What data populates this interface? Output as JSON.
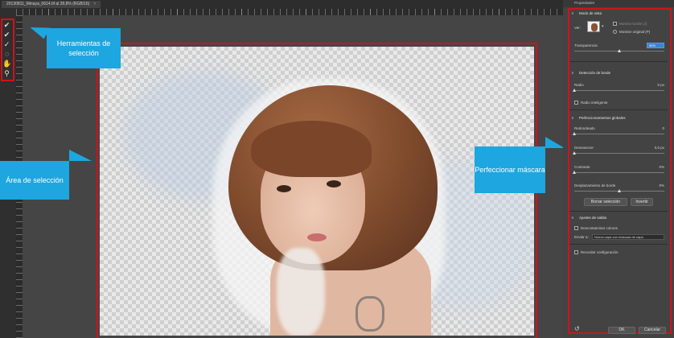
{
  "document": {
    "tab_title": "20130811_Minaya_0614.tif al 28,8% (RGB/16)",
    "tab_close": "×"
  },
  "tools": {
    "quick_selection": "quick-selection-icon",
    "refine_brush": "refine-edge-brush-icon",
    "brush": "brush-icon",
    "lasso": "lasso-icon",
    "hand": "hand-icon",
    "zoom": "zoom-icon"
  },
  "callouts": {
    "tools": "Herramientas de selección",
    "area": "Área de selección",
    "mask": "Perfeccionar máscara"
  },
  "panel": {
    "view_mode": {
      "section_title": "Modo de vista",
      "view_label": "Ver:",
      "show_edge": "Mostrar borde (J)",
      "show_original": "Mostrar original (P)",
      "transparency_label": "Transparencia",
      "transparency_value": "50%",
      "transparency_fraction": 0.5
    },
    "edge_detection": {
      "section_title": "Detección de borde",
      "radius_label": "Radio",
      "radius_value": "0 px",
      "smart_radius": "Radio inteligente"
    },
    "global_refinements": {
      "section_title": "Perfeccionamientos globales",
      "smooth_label": "Redondeado",
      "smooth_value": "0",
      "feather_label": "Desvanecer",
      "feather_value": "0,0 px",
      "contrast_label": "Contraste",
      "contrast_value": "0%",
      "shift_edge_label": "Desplazamiento de borde",
      "shift_edge_value": "0%",
      "shift_edge_fraction": 0.5,
      "clear_button": "Borrar selección",
      "invert_button": "Invertir"
    },
    "output": {
      "section_title": "Ajustes de salida",
      "decontaminate": "Descontaminar colores",
      "output_to_label": "Enviar a:",
      "output_to_value": "Nueva capa con máscara de capa",
      "remember": "Recordar configuración"
    },
    "ok_button": "OK",
    "cancel_button": "Cancelar"
  }
}
